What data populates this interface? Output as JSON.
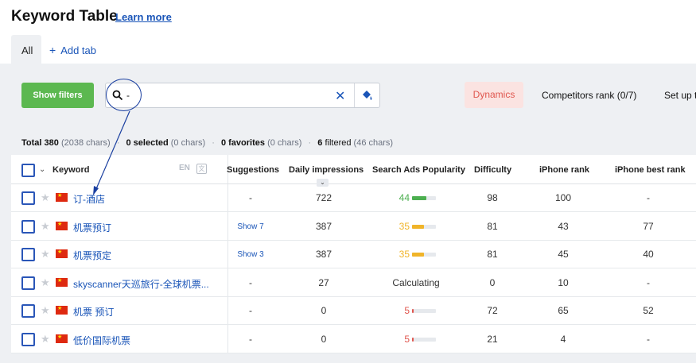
{
  "header": {
    "title": "Keyword Table",
    "learn_more": "Learn more"
  },
  "tabs": {
    "all": "All",
    "add": "Add tab"
  },
  "toolbar": {
    "show_filters": "Show filters",
    "search_value": "-",
    "dynamics": "Dynamics",
    "competitors_rank": "Competitors rank (0/7)",
    "setup": "Set up t"
  },
  "summary": {
    "total_label": "Total 380",
    "total_chars": "(2038 chars)",
    "selected_label": "0 selected",
    "selected_chars": "(0 chars)",
    "favorites_label": "0 favorites",
    "favorites_chars": "(0 chars)",
    "filtered_count": "6",
    "filtered_label": "filtered",
    "filtered_chars": "(46 chars)"
  },
  "table": {
    "columns": {
      "keyword": "Keyword",
      "en": "EN",
      "suggestions": "Suggestions",
      "daily_impressions": "Daily impressions",
      "search_ads_popularity": "Search Ads Popularity",
      "difficulty": "Difficulty",
      "iphone_rank": "iPhone rank",
      "iphone_best_rank": "iPhone best rank"
    },
    "rows": [
      {
        "keyword": "订-酒店",
        "suggestions": "-",
        "impressions": "722",
        "popularity": "44",
        "pop_level": 0.44,
        "pop_color": "#4caf50",
        "difficulty": "98",
        "iphone_rank": "100",
        "best_rank": "-"
      },
      {
        "keyword": "机票预订",
        "suggestions": "Show 7",
        "impressions": "387",
        "popularity": "35",
        "pop_level": 0.35,
        "pop_color": "#f0b429",
        "difficulty": "81",
        "iphone_rank": "43",
        "best_rank": "77"
      },
      {
        "keyword": "机票预定",
        "suggestions": "Show 3",
        "impressions": "387",
        "popularity": "35",
        "pop_level": 0.35,
        "pop_color": "#f0b429",
        "difficulty": "81",
        "iphone_rank": "45",
        "best_rank": "40"
      },
      {
        "keyword": "skyscanner天巡旅行-全球机票...",
        "suggestions": "-",
        "impressions": "27",
        "popularity": "Calculating",
        "pop_level": null,
        "pop_color": "",
        "difficulty": "0",
        "iphone_rank": "10",
        "best_rank": "-"
      },
      {
        "keyword": "机票 预订",
        "suggestions": "-",
        "impressions": "0",
        "popularity": "5",
        "pop_level": 0.05,
        "pop_color": "#e0574f",
        "difficulty": "72",
        "iphone_rank": "65",
        "best_rank": "52"
      },
      {
        "keyword": "低价国际机票",
        "suggestions": "-",
        "impressions": "0",
        "popularity": "5",
        "pop_level": 0.05,
        "pop_color": "#e0574f",
        "difficulty": "21",
        "iphone_rank": "4",
        "best_rank": "-"
      }
    ]
  }
}
